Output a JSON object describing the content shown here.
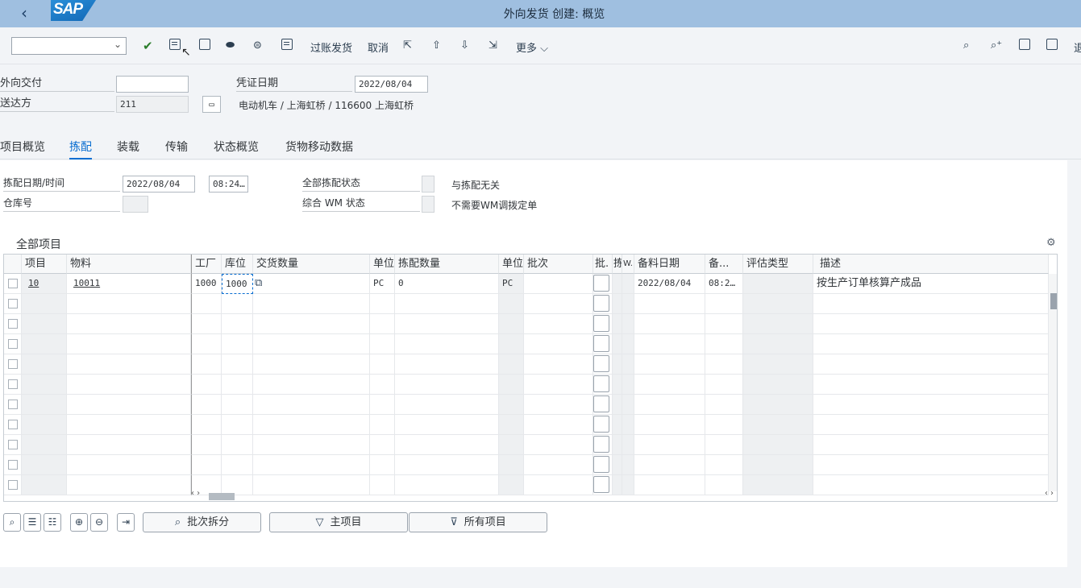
{
  "titlebar": {
    "title": "外向发货 创建: 概览",
    "logo": "SAP"
  },
  "toolbar": {
    "post": "过账发货",
    "cancel": "取消",
    "more": "更多",
    "icons": [
      "check-icon",
      "save-icon",
      "export-icon",
      "hat-icon",
      "assign-icon",
      "document-icon",
      "up-first-icon",
      "up-icon",
      "down-icon",
      "down-last-icon",
      "search-icon",
      "search-plus-icon",
      "window-icon",
      "window2-icon"
    ],
    "exit_partial": "退"
  },
  "header": {
    "outbound_delivery_label": "外向交付",
    "outbound_delivery_value": "",
    "ship_to_label": "送达方",
    "ship_to_value": "211",
    "doc_date_label": "凭证日期",
    "doc_date_value": "2022/08/04",
    "ship_to_desc": "电动机车 / 上海虹桥 / 116600 上海虹桥"
  },
  "tabs": [
    "项目概览",
    "拣配",
    "装载",
    "传输",
    "状态概览",
    "货物移动数据"
  ],
  "active_tab": "拣配",
  "picking": {
    "date_time_label": "拣配日期/时间",
    "date_value": "2022/08/04",
    "time_value": "08:24…",
    "warehouse_label": "仓库号",
    "overall_status_label": "全部拣配状态",
    "overall_status_text": "与拣配无关",
    "wm_status_label": "综合 WM 状态",
    "wm_status_text": "不需要WM调拨定单"
  },
  "table": {
    "title": "全部项目",
    "columns": [
      "项目",
      "物料",
      "工厂",
      "库位",
      "交货数量",
      "单位",
      "拣配数量",
      "单位",
      "批次",
      "批.",
      "拣",
      "W.",
      "备料日期",
      "备...",
      "评估类型",
      "描述"
    ],
    "rows": [
      {
        "item": "10",
        "material": "10011",
        "plant": "1000",
        "sloc": "1000",
        "deliv_qty": "",
        "unit": "PC",
        "pick_qty": "0",
        "pick_unit": "PC",
        "batch": "",
        "avail_date": "2022/08/04",
        "avail_time": "08:2…",
        "val_type": "",
        "desc": "按生产订单核算产成品"
      }
    ],
    "empty_rows": 10
  },
  "bottom": {
    "batch_split": "批次拆分",
    "main_items": "主项目",
    "all_items": "所有项目"
  }
}
